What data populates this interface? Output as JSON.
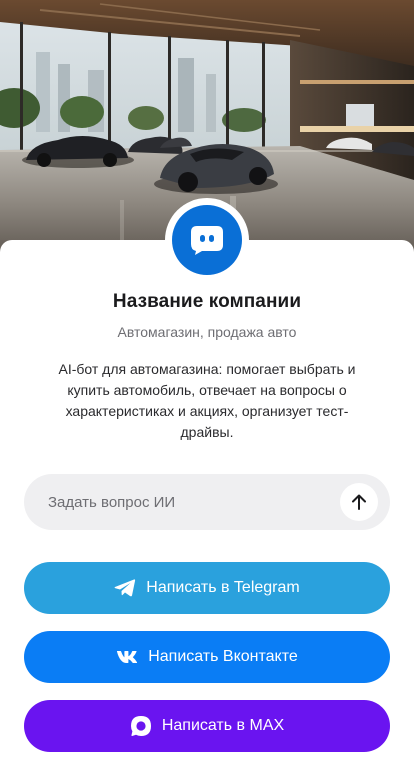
{
  "company": {
    "name": "Название компании",
    "subtitle": "Автомагазин, продажа авто",
    "description": "AI-бот для автомагазина: помогает выбрать и купить автомобиль, отвечает на вопросы о характеристиках и акциях, организует тест-драйвы."
  },
  "ask": {
    "placeholder": "Задать вопрос ИИ",
    "value": ""
  },
  "buttons": {
    "telegram": "Написать в Telegram",
    "vk": "Написать Вконтакте",
    "max": "Написать в MAX"
  },
  "icons": {
    "avatar": "chat-bot-icon",
    "send": "arrow-up-icon",
    "telegram": "telegram-icon",
    "vk": "vk-icon",
    "max": "max-icon"
  },
  "colors": {
    "avatar": "#0a6fd6",
    "telegram": "#2aa1dd",
    "vk": "#0a7df5",
    "max": "#6a14f0",
    "ask_background": "#efeff1"
  }
}
